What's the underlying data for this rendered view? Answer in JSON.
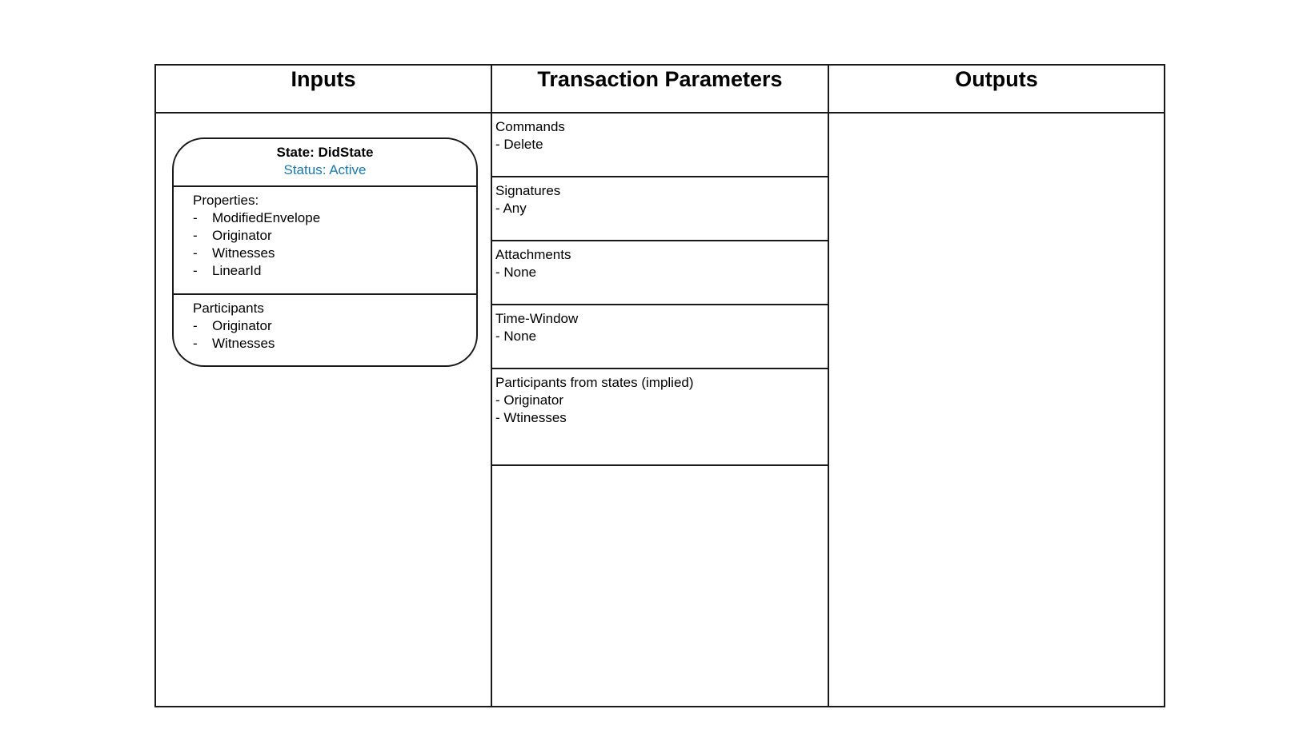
{
  "columns": {
    "inputs": "Inputs",
    "params": "Transaction Parameters",
    "outputs": "Outputs"
  },
  "state": {
    "title": "State: DidState",
    "status": "Status: Active",
    "properties_label": "Properties:",
    "properties": [
      "ModifiedEnvelope",
      "Originator",
      "Witnesses",
      "LinearId"
    ],
    "participants_label": "Participants",
    "participants": [
      "Originator",
      "Witnesses"
    ],
    "bullet": "-"
  },
  "params": [
    {
      "label": "Commands",
      "items": [
        "- Delete"
      ]
    },
    {
      "label": "Signatures",
      "items": [
        "- Any"
      ]
    },
    {
      "label": "Attachments",
      "items": [
        "- None"
      ]
    },
    {
      "label": "Time-Window",
      "items": [
        "- None"
      ]
    },
    {
      "label": "Participants from states (implied)",
      "items": [
        "- Originator",
        "- Wtinesses"
      ]
    }
  ],
  "colors": {
    "status": "#1a78b0",
    "border": "#1a1a1a"
  }
}
